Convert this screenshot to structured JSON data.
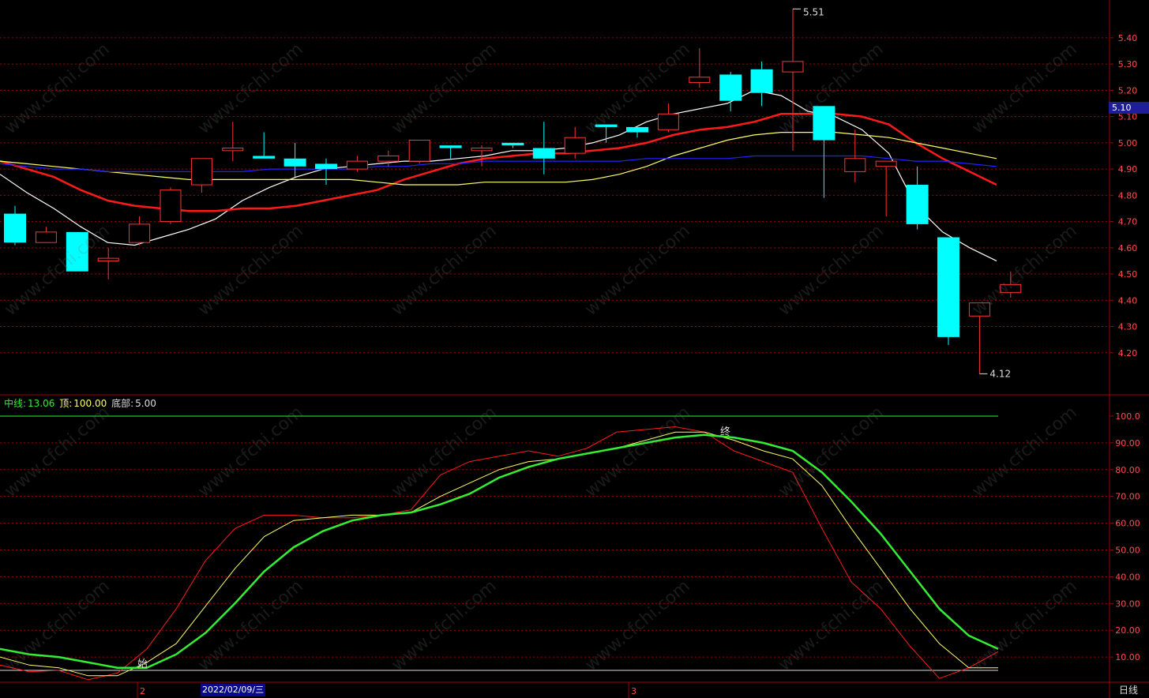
{
  "chart_data": [
    {
      "type": "candlestick",
      "y_axis_ticks": [
        "5.40",
        "5.30",
        "5.20",
        "5.10",
        "5.00",
        "4.90",
        "4.80",
        "4.70",
        "4.60",
        "4.50",
        "4.40",
        "4.30",
        "4.20"
      ],
      "ylim": [
        4.07,
        5.52
      ],
      "current_price_label": "5.10",
      "high_label": "5.51",
      "low_label": "4.12",
      "candles": [
        {
          "o": 4.73,
          "h": 4.76,
          "l": 4.61,
          "c": 4.62
        },
        {
          "o": 4.62,
          "h": 4.68,
          "l": 4.62,
          "c": 4.66
        },
        {
          "o": 4.66,
          "h": 4.66,
          "l": 4.51,
          "c": 4.51
        },
        {
          "o": 4.55,
          "h": 4.6,
          "l": 4.48,
          "c": 4.56
        },
        {
          "o": 4.62,
          "h": 4.72,
          "l": 4.61,
          "c": 4.69
        },
        {
          "o": 4.7,
          "h": 4.83,
          "l": 4.69,
          "c": 4.82
        },
        {
          "o": 4.84,
          "h": 4.94,
          "l": 4.81,
          "c": 4.94
        },
        {
          "o": 4.97,
          "h": 5.08,
          "l": 4.93,
          "c": 4.98
        },
        {
          "o": 4.95,
          "h": 5.04,
          "l": 4.94,
          "c": 4.94
        },
        {
          "o": 4.94,
          "h": 5.0,
          "l": 4.87,
          "c": 4.91
        },
        {
          "o": 4.92,
          "h": 4.94,
          "l": 4.84,
          "c": 4.9
        },
        {
          "o": 4.9,
          "h": 4.95,
          "l": 4.89,
          "c": 4.93
        },
        {
          "o": 4.93,
          "h": 4.97,
          "l": 4.91,
          "c": 4.95
        },
        {
          "o": 4.93,
          "h": 5.01,
          "l": 4.92,
          "c": 5.01
        },
        {
          "o": 4.99,
          "h": 4.99,
          "l": 4.94,
          "c": 4.98
        },
        {
          "o": 4.97,
          "h": 4.99,
          "l": 4.91,
          "c": 4.98
        },
        {
          "o": 5.0,
          "h": 5.0,
          "l": 4.98,
          "c": 4.99
        },
        {
          "o": 4.98,
          "h": 5.08,
          "l": 4.88,
          "c": 4.94
        },
        {
          "o": 4.96,
          "h": 5.06,
          "l": 4.94,
          "c": 5.02
        },
        {
          "o": 5.07,
          "h": 5.07,
          "l": 5.0,
          "c": 5.06
        },
        {
          "o": 5.06,
          "h": 5.06,
          "l": 5.02,
          "c": 5.04
        },
        {
          "o": 5.05,
          "h": 5.15,
          "l": 5.04,
          "c": 5.11
        },
        {
          "o": 5.23,
          "h": 5.36,
          "l": 5.21,
          "c": 5.25
        },
        {
          "o": 5.26,
          "h": 5.27,
          "l": 5.12,
          "c": 5.16
        },
        {
          "o": 5.28,
          "h": 5.31,
          "l": 5.14,
          "c": 5.19
        },
        {
          "o": 5.27,
          "h": 5.51,
          "l": 4.97,
          "c": 5.31
        },
        {
          "o": 5.14,
          "h": 5.14,
          "l": 4.79,
          "c": 5.01
        },
        {
          "o": 4.89,
          "h": 5.05,
          "l": 4.85,
          "c": 4.94
        },
        {
          "o": 4.91,
          "h": 4.93,
          "l": 4.72,
          "c": 4.93
        },
        {
          "o": 4.84,
          "h": 4.91,
          "l": 4.67,
          "c": 4.69
        },
        {
          "o": 4.64,
          "h": 4.64,
          "l": 4.23,
          "c": 4.26
        },
        {
          "o": 4.34,
          "h": 4.39,
          "l": 4.12,
          "c": 4.39
        },
        {
          "o": 4.43,
          "h": 4.51,
          "l": 4.41,
          "c": 4.46
        }
      ],
      "series": [
        {
          "color": "#ffffff",
          "values": [
            4.88,
            4.81,
            4.75,
            4.68,
            4.62,
            4.61,
            4.64,
            4.67,
            4.71,
            4.78,
            4.83,
            4.87,
            4.9,
            4.91,
            4.92,
            4.93,
            4.93,
            4.94,
            4.95,
            4.97,
            4.97,
            4.98,
            5.0,
            5.03,
            5.08,
            5.11,
            5.13,
            5.15,
            5.2,
            5.18,
            5.12,
            5.1,
            5.05,
            4.96,
            4.76,
            4.66,
            4.6,
            4.55
          ]
        },
        {
          "color": "#ff1a1a",
          "values": [
            4.93,
            4.9,
            4.87,
            4.82,
            4.78,
            4.76,
            4.75,
            4.74,
            4.74,
            4.75,
            4.75,
            4.76,
            4.78,
            4.8,
            4.82,
            4.86,
            4.89,
            4.92,
            4.94,
            4.95,
            4.96,
            4.96,
            4.97,
            4.98,
            5.0,
            5.03,
            5.05,
            5.06,
            5.08,
            5.11,
            5.11,
            5.11,
            5.1,
            5.07,
            5.0,
            4.94,
            4.89,
            4.84
          ]
        },
        {
          "color": "#ffff66",
          "values": [
            4.93,
            4.92,
            4.91,
            4.9,
            4.89,
            4.88,
            4.87,
            4.86,
            4.86,
            4.86,
            4.86,
            4.86,
            4.86,
            4.86,
            4.85,
            4.84,
            4.84,
            4.84,
            4.85,
            4.85,
            4.85,
            4.85,
            4.86,
            4.88,
            4.91,
            4.95,
            4.98,
            5.01,
            5.03,
            5.04,
            5.04,
            5.04,
            5.03,
            5.02,
            5.0,
            4.98,
            4.96,
            4.94
          ]
        },
        {
          "color": "#2222ff",
          "values": [
            4.92,
            4.91,
            4.9,
            4.9,
            4.89,
            4.89,
            4.89,
            4.89,
            4.89,
            4.89,
            4.9,
            4.9,
            4.9,
            4.9,
            4.91,
            4.91,
            4.92,
            4.92,
            4.93,
            4.93,
            4.93,
            4.93,
            4.93,
            4.93,
            4.94,
            4.94,
            4.94,
            4.94,
            4.95,
            4.95,
            4.95,
            4.95,
            4.95,
            4.94,
            4.93,
            4.93,
            4.92,
            4.91
          ]
        }
      ]
    },
    {
      "type": "line",
      "y_axis_ticks": [
        "100.0",
        "90.00",
        "80.00",
        "70.00",
        "60.00",
        "50.00",
        "40.00",
        "30.00",
        "20.00",
        "10.00"
      ],
      "ylim": [
        0,
        105
      ],
      "series": [
        {
          "color": "#ff1a1a",
          "values": [
            7,
            4.5,
            5,
            1.5,
            4,
            13,
            28,
            46,
            58,
            63,
            63,
            62,
            62,
            63,
            65,
            78,
            83,
            85,
            87,
            85,
            88,
            94,
            95,
            96,
            94,
            87,
            83,
            79,
            58,
            38,
            28,
            14,
            2,
            6,
            12
          ]
        },
        {
          "color": "#ffff66",
          "values": [
            10,
            7,
            6,
            3,
            3,
            8,
            15,
            29,
            43,
            55,
            61,
            62,
            63,
            63,
            64,
            70,
            75,
            80,
            83,
            84,
            86,
            88,
            91,
            94,
            94,
            91,
            87,
            84,
            74,
            58,
            43,
            28,
            15,
            6,
            6
          ]
        },
        {
          "color": "#33ee33",
          "values": [
            13,
            11,
            10,
            8,
            6,
            6,
            11,
            19,
            30,
            42,
            51,
            57,
            61,
            63,
            64,
            67,
            71,
            77,
            81,
            84,
            86,
            88,
            90,
            92,
            93,
            92,
            90,
            87,
            79,
            68,
            56,
            42,
            28,
            18,
            13
          ]
        }
      ],
      "markers": {
        "start": "始",
        "end": "终"
      }
    }
  ],
  "indicator": {
    "label_mid": "中线:",
    "mid_value": "13.06",
    "label_top": "顶:",
    "top_value": "100.00",
    "label_bottom": "底部:",
    "bottom_value": "5.00"
  },
  "x_axis": {
    "month_marks": [
      "2",
      "3"
    ],
    "cursor_date": "2022/02/09/三"
  },
  "period": "日线",
  "watermark": "www.cfchi.com",
  "colors": {
    "up": "#ff3333",
    "down": "#00ffff",
    "grid": "#a00000",
    "axis_text": "#ff4d4d"
  }
}
